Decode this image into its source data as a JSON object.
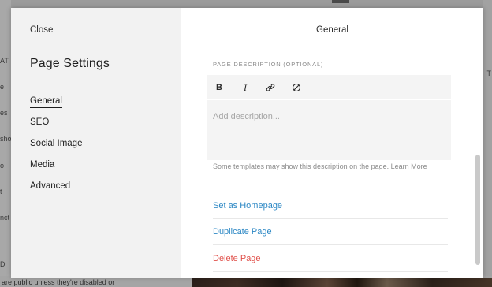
{
  "background": {
    "left_fragments": [
      "AT",
      "e",
      "es",
      "sho",
      "o",
      "t",
      "nct",
      "D"
    ],
    "right_fragment": "T",
    "bottom_text": "are public unless they're disabled or"
  },
  "modal": {
    "close_label": "Close",
    "title": "Page Settings",
    "nav": [
      {
        "label": "General",
        "active": true
      },
      {
        "label": "SEO",
        "active": false
      },
      {
        "label": "Social Image",
        "active": false
      },
      {
        "label": "Media",
        "active": false
      },
      {
        "label": "Advanced",
        "active": false
      }
    ],
    "main": {
      "title": "General",
      "description_label": "PAGE DESCRIPTION (OPTIONAL)",
      "toolbar": {
        "bold": "B",
        "italic": "I",
        "link_icon": "link-icon",
        "clear_icon": "clear-format-icon"
      },
      "description_placeholder": "Add description...",
      "help_text": "Some templates may show this description on the page.",
      "learn_more": "Learn More",
      "actions": {
        "set_homepage": "Set as Homepage",
        "duplicate": "Duplicate Page",
        "delete": "Delete Page"
      }
    }
  },
  "colors": {
    "link": "#2b87c4",
    "danger": "#e0504a",
    "sidebar_bg": "#f2f2f2"
  }
}
